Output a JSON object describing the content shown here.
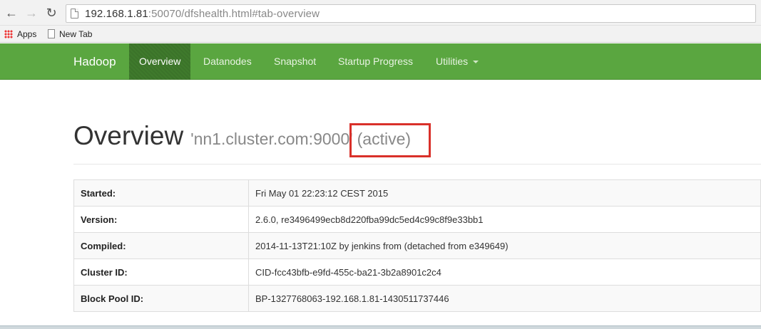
{
  "browser": {
    "url_host": "192.168.1.81",
    "url_rest": ":50070/dfshealth.html#tab-overview",
    "bookmarks": [
      "Apps",
      "New Tab"
    ]
  },
  "navbar": {
    "brand": "Hadoop",
    "items": [
      {
        "label": "Overview",
        "active": true
      },
      {
        "label": "Datanodes"
      },
      {
        "label": "Snapshot"
      },
      {
        "label": "Startup Progress"
      },
      {
        "label": "Utilities"
      }
    ]
  },
  "overview": {
    "title": "Overview",
    "host": "'nn1.cluster.com:9000'",
    "status": "(active)"
  },
  "info_rows": [
    {
      "label": "Started:",
      "value": "Fri May 01 22:23:12 CEST 2015"
    },
    {
      "label": "Version:",
      "value": "2.6.0, re3496499ecb8d220fba99dc5ed4c99c8f9e33bb1"
    },
    {
      "label": "Compiled:",
      "value": "2014-11-13T21:10Z by jenkins from (detached from e349649)"
    },
    {
      "label": "Cluster ID:",
      "value": "CID-fcc43bfb-e9fd-455c-ba21-3b2a8901c2c4"
    },
    {
      "label": "Block Pool ID:",
      "value": "BP-1327768063-192.168.1.81-1430511737446"
    }
  ],
  "colors": {
    "navbar": "#5aa640",
    "navbar_active": "#3f7a2c",
    "highlight": "#d9302a"
  }
}
